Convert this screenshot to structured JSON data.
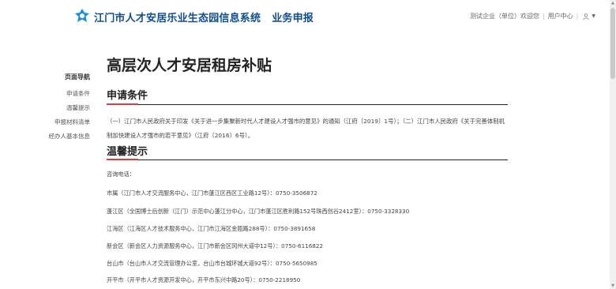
{
  "header": {
    "site_title": "江门市人才安居乐业生态园信息系统",
    "module_title": "业务申报",
    "user_welcome": "测试企业（单位）欢迎您",
    "user_center": "用户中心"
  },
  "side_nav": {
    "title": "页面导航",
    "items": [
      {
        "label": "申请条件"
      },
      {
        "label": "温馨提示"
      },
      {
        "label": "申报材料清单"
      },
      {
        "label": "经办人基本信息"
      }
    ]
  },
  "page": {
    "title": "高层次人才安居租房补贴"
  },
  "sections": {
    "conditions": {
      "heading": "申请条件",
      "text": "（一）江门市人民政府关于印发《关于进一步集聚新时代人才建设人才强市的意见》的通知（江府〔2019〕1号）；（二）江门市人民政府《关于完善体制机制加快建设人才强市的若干意见》（江府〔2016〕6号）。"
    },
    "tips": {
      "heading": "温馨提示",
      "intro": "咨询电话：",
      "contacts": [
        {
          "text": "市属（江门市人才交流服务中心，江门市蓬江区西区工业路12号）：0750-3506872"
        },
        {
          "text": "蓬江区（全国博士后创新（江门）示范中心蓬江分中心，江门市蓬江区胜利路152号珠西创谷2412室）：0750-3328330"
        },
        {
          "text": "江海区（江海区人才技术服务中心，江门市江海区金瓯路288号）：0750-3891658"
        },
        {
          "text": "新会区（新会区人力资源服务中心，江门市新会区冈州大道中12号）：0750-6116822"
        },
        {
          "text": "台山市（台山市人才交流管理办公室，台山市台城环城大道92号）：0750-5650985"
        },
        {
          "text": "开平市（开平市人才资源开发中心，开平市东兴中路20号）：0750-2218950"
        }
      ]
    }
  },
  "colors": {
    "brand": "#0f4f8f",
    "accent": "#e23b3b",
    "logo": "#1a8fd8"
  }
}
